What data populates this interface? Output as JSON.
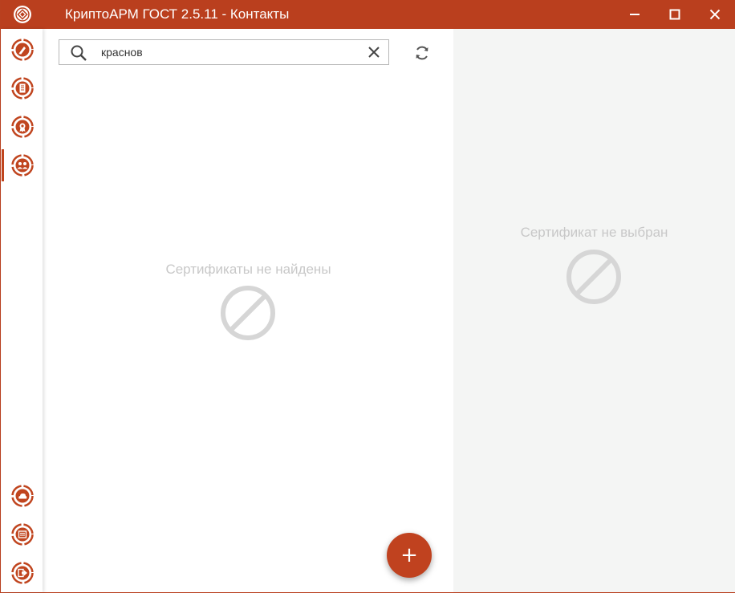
{
  "window": {
    "title": "КриптоАРМ ГОСТ 2.5.11 - Контакты"
  },
  "colors": {
    "accent": "#ba3f1e",
    "muted_text": "#c8c8c8",
    "detail_bg": "#f4f5f4"
  },
  "sidebar": {
    "items": [
      {
        "icon": "sign-pen-icon",
        "active": false
      },
      {
        "icon": "documents-icon",
        "active": false
      },
      {
        "icon": "certificate-icon",
        "active": false
      },
      {
        "icon": "contacts-icon",
        "active": true
      },
      {
        "icon": "cloud-icon",
        "active": false
      },
      {
        "icon": "log-list-icon",
        "active": false
      },
      {
        "icon": "exit-icon",
        "active": false
      }
    ]
  },
  "search": {
    "value": "краснов",
    "placeholder": ""
  },
  "list": {
    "empty_message": "Сертификаты не найдены"
  },
  "detail": {
    "empty_message": "Сертификат не выбран"
  },
  "fab": {
    "label": "+"
  }
}
